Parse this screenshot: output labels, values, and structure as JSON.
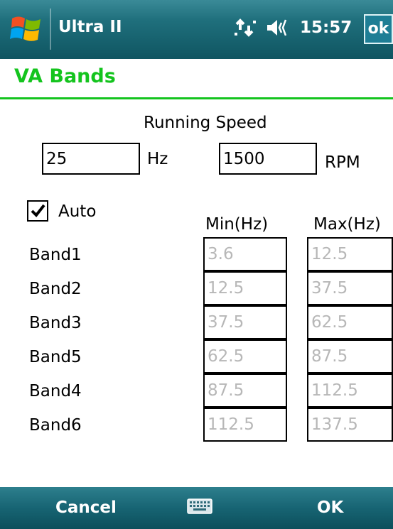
{
  "titlebar": {
    "app_title": "Ultra II",
    "time": "15:57",
    "ok_label": "ok",
    "icons": [
      "windows-start-icon",
      "connectivity-icon",
      "speaker-icon"
    ]
  },
  "page": {
    "title": "VA Bands",
    "accent_color": "#14c41e"
  },
  "running_speed": {
    "label": "Running Speed",
    "hz_value": "25",
    "hz_unit": "Hz",
    "rpm_value": "1500",
    "rpm_unit": "RPM"
  },
  "auto": {
    "label": "Auto",
    "checked": true
  },
  "bands": {
    "min_header": "Min(Hz)",
    "max_header": "Max(Hz)",
    "rows": [
      {
        "name": "Band1",
        "min": "3.6",
        "max": "12.5"
      },
      {
        "name": "Band2",
        "min": "12.5",
        "max": "37.5"
      },
      {
        "name": "Band3",
        "min": "37.5",
        "max": "62.5"
      },
      {
        "name": "Band5",
        "min": "62.5",
        "max": "87.5"
      },
      {
        "name": "Band4",
        "min": "87.5",
        "max": "112.5"
      },
      {
        "name": "Band6",
        "min": "112.5",
        "max": "137.5"
      }
    ]
  },
  "softkeys": {
    "left": "Cancel",
    "right": "OK",
    "center_icon": "keyboard-icon"
  }
}
